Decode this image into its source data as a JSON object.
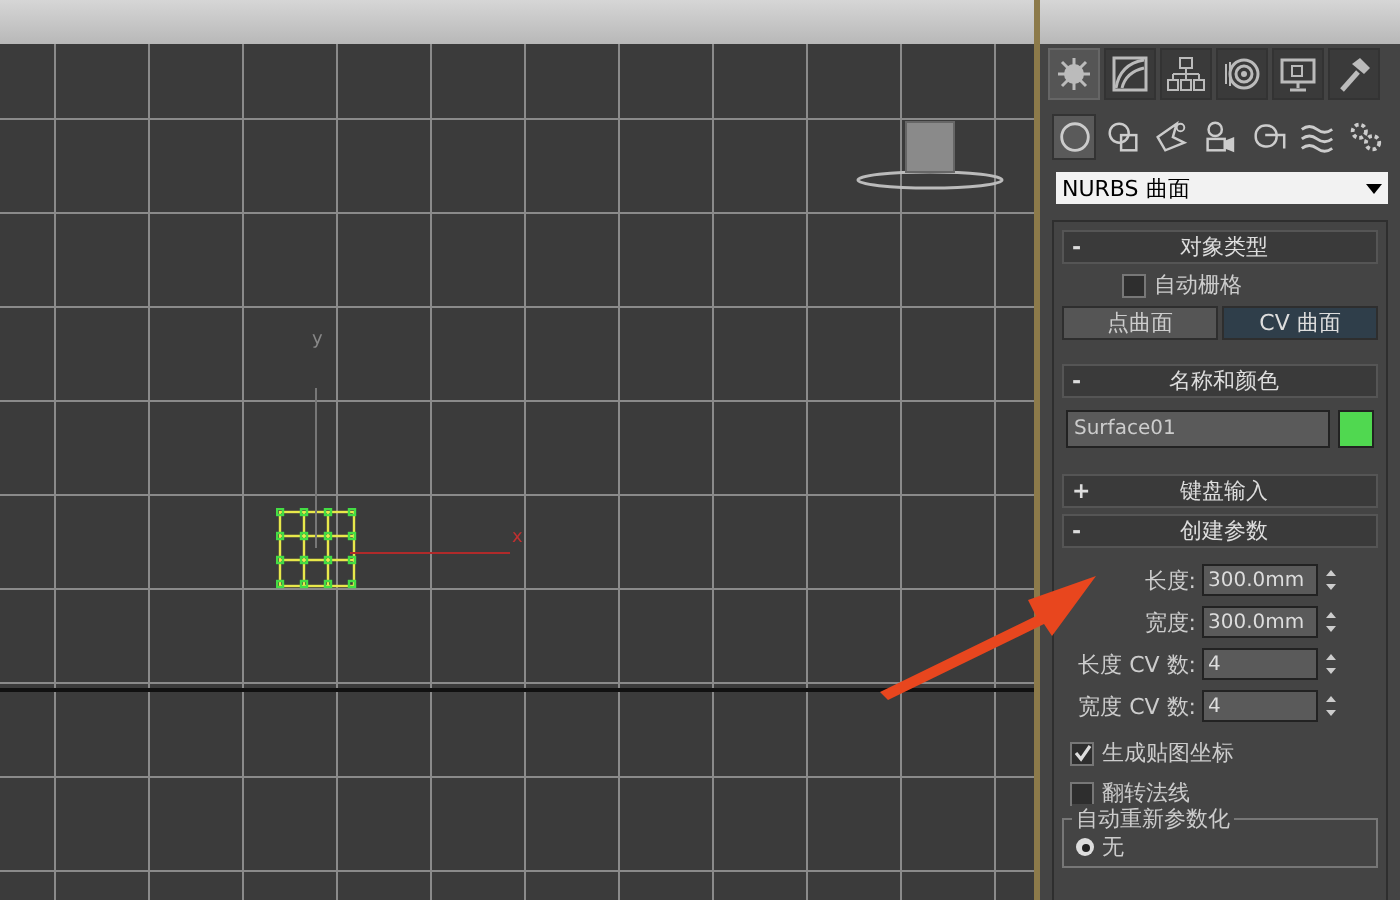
{
  "command_tabs": [
    {
      "selected": true
    },
    {
      "selected": false
    },
    {
      "selected": false
    },
    {
      "selected": false
    },
    {
      "selected": false
    },
    {
      "selected": false
    }
  ],
  "category_tabs": [
    {
      "selected": true
    },
    {
      "selected": false
    },
    {
      "selected": false
    },
    {
      "selected": false
    },
    {
      "selected": false
    },
    {
      "selected": false
    },
    {
      "selected": false
    }
  ],
  "type_dropdown": {
    "value": "NURBS 曲面"
  },
  "viewport": {
    "y_label": "y",
    "x_label": "x"
  },
  "object_type": {
    "sign": "-",
    "title": "对象类型",
    "autogrid": {
      "label": "自动栅格",
      "checked": false
    },
    "buttons": [
      {
        "label": "点曲面",
        "selected": false
      },
      {
        "label": "CV 曲面",
        "selected": true
      }
    ]
  },
  "name_and_color": {
    "sign": "-",
    "title": "名称和颜色",
    "name": "Surface01",
    "color": "#50d850"
  },
  "keyboard_entry": {
    "sign": "+",
    "title": "键盘输入"
  },
  "creation_params": {
    "sign": "-",
    "title": "创建参数",
    "fields": [
      {
        "label": "长度:",
        "value": "300.0mm"
      },
      {
        "label": "宽度:",
        "value": "300.0mm"
      },
      {
        "label": "长度 CV 数:",
        "value": "4"
      },
      {
        "label": "宽度 CV 数:",
        "value": "4"
      }
    ],
    "checkboxes": [
      {
        "label": "生成贴图坐标",
        "checked": true
      },
      {
        "label": "翻转法线",
        "checked": false
      }
    ],
    "group_title": "自动重新参数化",
    "radios": [
      {
        "label": "无",
        "selected": true
      }
    ]
  }
}
